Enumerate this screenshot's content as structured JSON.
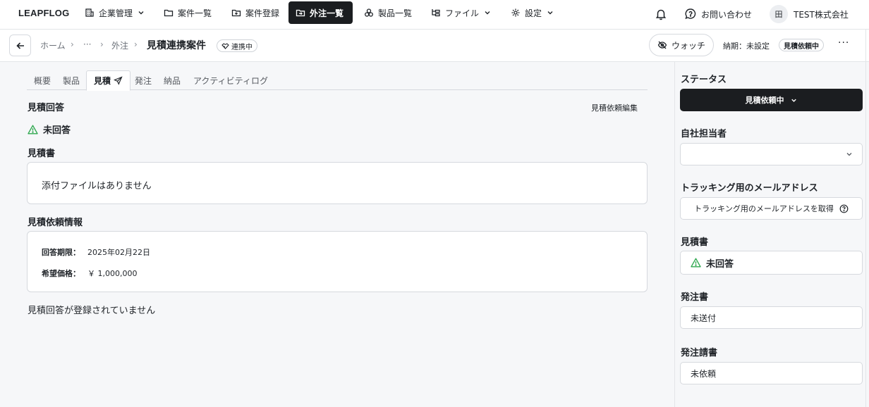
{
  "nav": {
    "logo": "LEAPFLOG",
    "items": [
      {
        "label": "企業管理",
        "icon": "building-icon",
        "dropdown": true
      },
      {
        "label": "案件一覧",
        "icon": "folder-icon"
      },
      {
        "label": "案件登録",
        "icon": "folder-plus-icon"
      },
      {
        "label": "外注一覧",
        "icon": "outsourcing-icon",
        "active": true
      },
      {
        "label": "製品一覧",
        "icon": "boxes-icon"
      },
      {
        "label": "ファイル",
        "icon": "file-tree-icon",
        "dropdown": true
      },
      {
        "label": "設定",
        "icon": "gear-icon",
        "dropdown": true
      }
    ],
    "contact_label": "お問い合わせ",
    "company_name": "TEST株式会社",
    "company_icon": "田"
  },
  "subheader": {
    "breadcrumbs": [
      "ホーム",
      "···",
      "外注"
    ],
    "title": "見積連携案件",
    "link_badge": "連携中",
    "watch_label": "ウォッチ",
    "deadline": "納期：未設定",
    "status_badge": "見積依頼中",
    "more": "···"
  },
  "tabs": [
    {
      "label": "概要"
    },
    {
      "label": "製品"
    },
    {
      "label": "見積",
      "active": true
    },
    {
      "label": "発注"
    },
    {
      "label": "納品"
    },
    {
      "label": "アクティビティログ"
    }
  ],
  "main": {
    "quote_answer_title": "見積回答",
    "edit_request_link": "見積依頼編集",
    "unanswered": "未回答",
    "quote_doc_title": "見積書",
    "no_attachments": "添付ファイルはありません",
    "request_info_title": "見積依頼情報",
    "answer_deadline_key": "回答期限：",
    "answer_deadline_value": "2025年02月22日",
    "desired_price_key": "希望価格：",
    "desired_price_value": "￥ 1,000,000",
    "no_answer_registered": "見積回答が登録されていません"
  },
  "sidebar": {
    "status_title": "ステータス",
    "status_value": "見積依頼中",
    "assignee_title": "自社担当者",
    "assignee_value": "",
    "tracking_title": "トラッキング用のメールアドレス",
    "tracking_button": "トラッキング用のメールアドレスを取得",
    "quote_title": "見積書",
    "quote_value": "未回答",
    "order_title": "発注書",
    "order_value": "未送付",
    "order_ack_title": "発注請書",
    "order_ack_value": "未依頼"
  },
  "colors": {
    "warning_green": "#2fa84f",
    "active_dark": "#1b1d20"
  }
}
